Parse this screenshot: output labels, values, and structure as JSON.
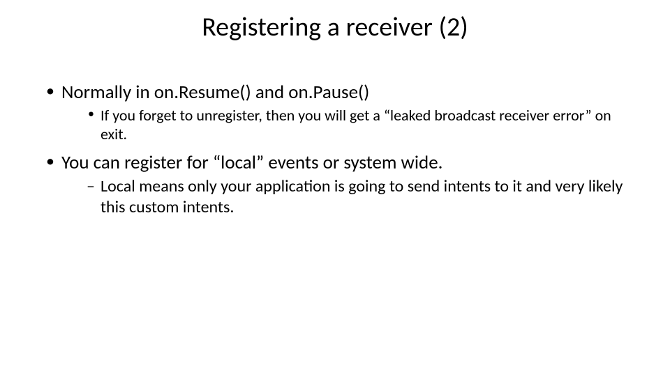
{
  "slide": {
    "title": "Registering a receiver (2)",
    "points": [
      {
        "text": "Normally in on.Resume() and on.Pause()",
        "children": [
          {
            "style": "bullet",
            "text": "If you forget to unregister, then you will get a “leaked broadcast receiver error” on exit."
          }
        ]
      },
      {
        "text": "You can register for “local” events or system wide.",
        "children": [
          {
            "style": "dash",
            "text": "Local means only your application is going to send intents to it and very likely this custom intents."
          }
        ]
      }
    ]
  }
}
